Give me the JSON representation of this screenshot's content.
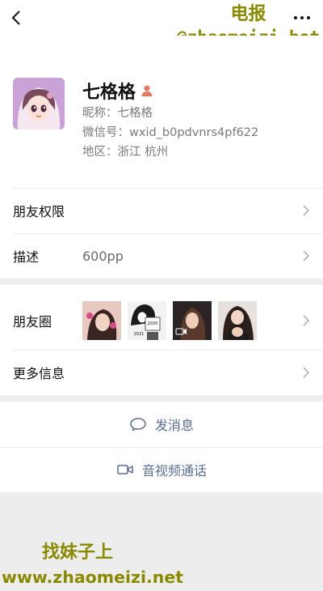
{
  "header": {
    "back_icon": "chevron-left-icon",
    "more_icon": "more-horizontal-icon",
    "watermark_line1": "电报",
    "watermark_line2": "@zhaomeizi_bot"
  },
  "profile": {
    "display_name": "七格格",
    "gender_icon": "female-user-icon",
    "nickname": "昵称：七格格",
    "wechat_id": "微信号：wxid_b0pdvnrs4pf622",
    "region": "地区：浙江  杭州"
  },
  "settings": {
    "permissions_label": "朋友权限",
    "description_label": "描述",
    "description_value": "600pp"
  },
  "moments": {
    "label": "朋友圈",
    "thumb_text_year1": "2020",
    "thumb_text_year2": "2021",
    "more_info_label": "更多信息"
  },
  "actions": {
    "message_label": "发消息",
    "call_label": "音视频通话",
    "accent_color": "#576b95"
  },
  "footer_watermark": {
    "line1": "找妹子上",
    "line2": "www.zhaomeizi.net"
  }
}
